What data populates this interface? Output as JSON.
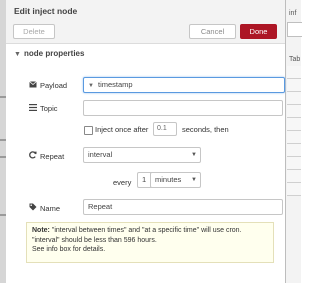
{
  "dialog": {
    "title": "Edit inject node",
    "delete_label": "Delete",
    "cancel_label": "Cancel",
    "done_label": "Done"
  },
  "section": {
    "title": "node properties"
  },
  "payload": {
    "label": "Payload",
    "type": "timestamp"
  },
  "topic": {
    "label": "Topic",
    "value": ""
  },
  "inject_once": {
    "label": "Inject once after",
    "delay": "0.1",
    "suffix": "seconds, then",
    "checked": false
  },
  "repeat": {
    "label": "Repeat",
    "value": "interval",
    "every_label": "every",
    "every_value": "1",
    "units": "minutes"
  },
  "name": {
    "label": "Name",
    "value": "Repeat"
  },
  "note": {
    "prefix": "Note:",
    "line1": " \"interval between times\" and \"at a specific time\" will use cron.",
    "line2": "\"interval\" should be less than 596 hours.",
    "line3": "See info box for details."
  },
  "sidebar": {
    "title": "inf",
    "tab_label": "Tab"
  },
  "colors": {
    "done_button": "#ad1625",
    "note_background": "#ffffee",
    "focus_border": "#5a9ae0"
  }
}
